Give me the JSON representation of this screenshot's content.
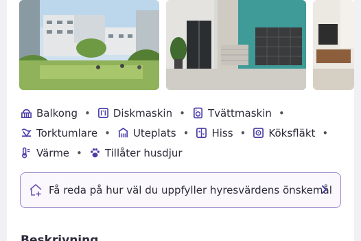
{
  "gallery": {
    "images": [
      {
        "subject": "apartment-buildings-courtyard"
      },
      {
        "subject": "stairwell-with-elevator-and-mailboxes"
      },
      {
        "subject": "apartment-interior"
      }
    ]
  },
  "amenities": {
    "rows": [
      [
        {
          "label": "Balkong",
          "icon": "balcony-icon"
        },
        {
          "label": "Diskmaskin",
          "icon": "dishwasher-icon"
        },
        {
          "label": "Tvättmaskin",
          "icon": "washing-machine-icon"
        }
      ],
      [
        {
          "label": "Torktumlare",
          "icon": "dryer-icon"
        },
        {
          "label": "Uteplats",
          "icon": "patio-icon"
        },
        {
          "label": "Hiss",
          "icon": "elevator-icon"
        },
        {
          "label": "Köksfläkt",
          "icon": "kitchen-fan-icon"
        }
      ],
      [
        {
          "label": "Värme",
          "icon": "heating-icon"
        },
        {
          "label": "Tillåter husdjur",
          "icon": "paw-icon"
        }
      ]
    ],
    "separator": "•"
  },
  "requirements": {
    "label": "Få reda på hur väl du uppfyller hyresvärdens önskemål",
    "icon": "house-plus-icon",
    "chevron_icon": "chevron-right-icon"
  },
  "next_section": {
    "title": "Beskrivning"
  },
  "colors": {
    "accent": "#4b3fa8",
    "banner_border": "#9b86c9",
    "banner_bg": "#faf8fd",
    "text": "#2b2b3a"
  }
}
